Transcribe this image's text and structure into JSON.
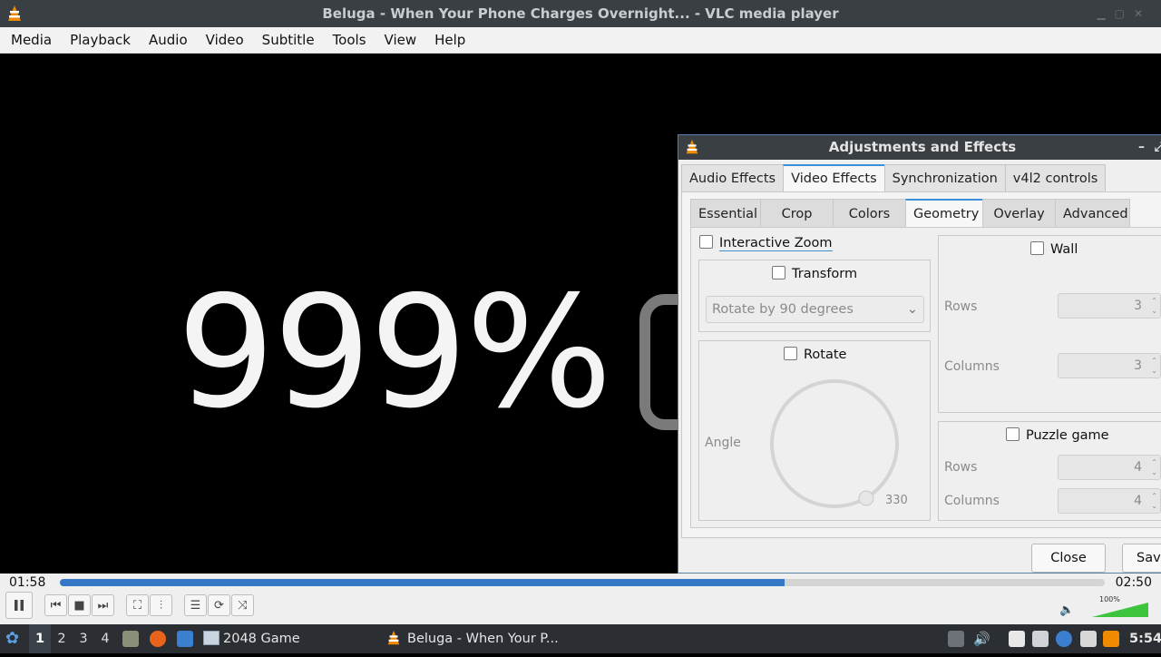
{
  "window": {
    "title": "Beluga - When Your Phone Charges Overnight... - VLC media player"
  },
  "menu": [
    "Media",
    "Playback",
    "Audio",
    "Video",
    "Subtitle",
    "Tools",
    "View",
    "Help"
  ],
  "video": {
    "overlay_text": "999%"
  },
  "dialog": {
    "title": "Adjustments and Effects",
    "tabs": [
      "Audio Effects",
      "Video Effects",
      "Synchronization",
      "v4l2 controls"
    ],
    "active_tab": "Video Effects",
    "subtabs": [
      "Essential",
      "Crop",
      "Colors",
      "Geometry",
      "Overlay",
      "Advanced"
    ],
    "active_subtab": "Geometry",
    "interactive_zoom": {
      "label": "Interactive Zoom",
      "checked": false
    },
    "transform": {
      "label": "Transform",
      "checked": false,
      "select_value": "Rotate by 90 degrees"
    },
    "rotate": {
      "label": "Rotate",
      "checked": false,
      "angle_label": "Angle",
      "angle_value": "330"
    },
    "wall": {
      "label": "Wall",
      "checked": false,
      "rows_label": "Rows",
      "rows_value": "3",
      "columns_label": "Columns",
      "columns_value": "3"
    },
    "puzzle": {
      "label": "Puzzle game",
      "checked": false,
      "rows_label": "Rows",
      "rows_value": "4",
      "columns_label": "Columns",
      "columns_value": "4"
    },
    "buttons": {
      "close": "Close",
      "save": "Save"
    }
  },
  "player": {
    "time_current": "01:58",
    "time_total": "02:50",
    "progress_fraction": 0.694,
    "volume_label": "100%",
    "volume_fraction": 1.0,
    "accent": "#3478c6"
  },
  "taskbar": {
    "workspaces": [
      "1",
      "2",
      "3",
      "4"
    ],
    "active_workspace": "1",
    "apps": [
      {
        "label": "2048 Game"
      },
      {
        "label": "Beluga - When Your P..."
      }
    ],
    "clock": "5:54"
  }
}
